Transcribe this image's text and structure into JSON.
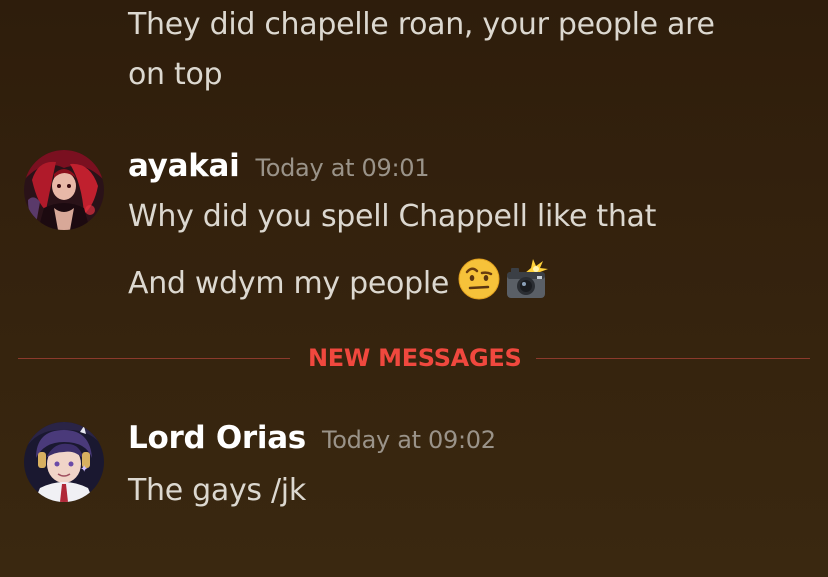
{
  "messages": [
    {
      "continued_lines": [
        "They did chapelle roan, your people are",
        "on top"
      ]
    },
    {
      "username": "ayakai",
      "timestamp": "Today at 09:01",
      "avatar_icon": "avatar-anime-red-hair",
      "lines": [
        "Why did you spell Chappell like that",
        "And wdym my people"
      ],
      "emojis": [
        "face-with-raised-eyebrow-emoji",
        "camera-with-flash-emoji"
      ]
    },
    {
      "username": "Lord Orias",
      "timestamp": "Today at 09:02",
      "avatar_icon": "avatar-anime-purple-hair-headphones",
      "lines": [
        "The gays /jk"
      ]
    }
  ],
  "divider": {
    "label": "NEW MESSAGES",
    "color": "#f0483e"
  },
  "colors": {
    "background": "#33210d",
    "username": "#ffffff",
    "timestamp": "#9a9389",
    "message_text": "#dcd8d0"
  }
}
